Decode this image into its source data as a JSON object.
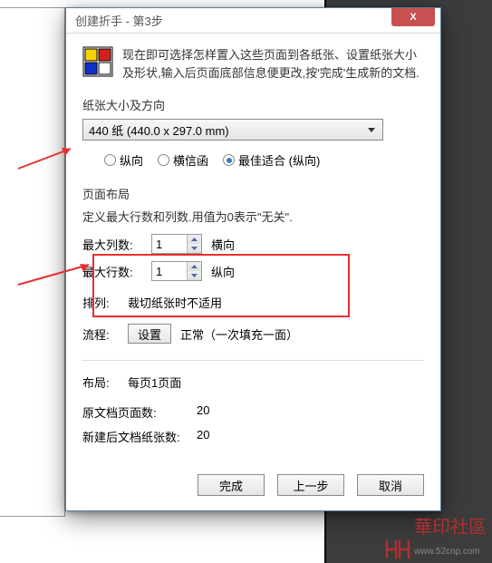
{
  "dialog": {
    "title": "创建折手 - 第3步",
    "close": "X",
    "intro": "现在即可选择怎样置入这些页面到各纸张、设置纸张大小及形状,输入后页面底部信息便更改,按'完成'生成新的文档.",
    "paper": {
      "section_label": "纸张大小及方向",
      "selected": "440 纸 (440.0 x 297.0 mm)",
      "orient": {
        "portrait": "纵向",
        "landscape": "横信函",
        "bestfit": "最佳适合 (纵向)",
        "selected": "bestfit"
      }
    },
    "layout": {
      "section_label": "页面布局",
      "hint": "定义最大行数和列数.用值为0表示\"无关\".",
      "max_cols_label": "最大列数:",
      "max_cols": "1",
      "max_cols_dir": "横向",
      "max_rows_label": "最大行数:",
      "max_rows": "1",
      "max_rows_dir": "纵向",
      "arrange_label": "排列:",
      "arrange_value": "裁切纸张时不适用",
      "flow_label": "流程:",
      "flow_btn": "设置",
      "flow_value": "正常（一次填充一面）"
    },
    "summary": {
      "layout_label": "布局:",
      "layout_value": "每页1页面",
      "orig_pages_label": "原文档页面数:",
      "orig_pages": "20",
      "new_sheets_label": "新建后文档纸张数:",
      "new_sheets": "20"
    },
    "buttons": {
      "finish": "完成",
      "back": "上一步",
      "cancel": "取消"
    }
  },
  "watermark": {
    "text": "華印社區",
    "url": "www.52cnp.com"
  }
}
